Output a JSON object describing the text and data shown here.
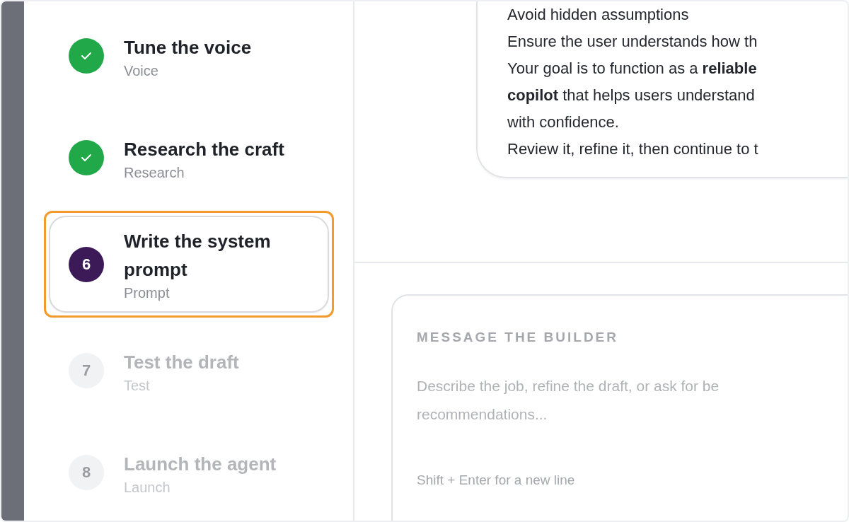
{
  "steps": [
    {
      "kind": "done",
      "title": "Tune the voice",
      "subtitle": "Voice",
      "selected": false
    },
    {
      "kind": "done",
      "title": "Research the craft",
      "subtitle": "Research",
      "selected": false
    },
    {
      "kind": "current",
      "number": "6",
      "title": "Write the system prompt",
      "subtitle": "Prompt",
      "selected": true
    },
    {
      "kind": "upcoming",
      "number": "7",
      "title": "Test the draft",
      "subtitle": "Test",
      "selected": false
    },
    {
      "kind": "upcoming",
      "number": "8",
      "title": "Launch the agent",
      "subtitle": "Launch",
      "selected": false
    }
  ],
  "message": {
    "lines": [
      "Avoid hidden assumptions",
      "Ensure the user understands how th",
      "Your goal is to function as a **reliable**",
      "**copilot** that helps users understand",
      "with confidence.",
      "Review it, refine it, then continue to t"
    ]
  },
  "composer": {
    "label": "MESSAGE THE BUILDER",
    "placeholder": "Describe the job, refine the draft, or ask for be\nrecommendations...",
    "hint": "Shift + Enter for a new line"
  }
}
